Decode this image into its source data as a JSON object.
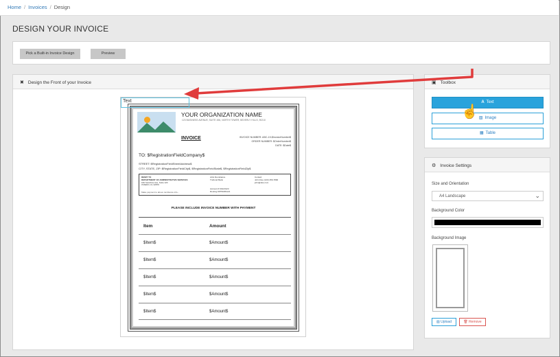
{
  "breadcrumb": {
    "home": "Home",
    "invoices": "Invoices",
    "current": "Design",
    "separator": "/"
  },
  "page": {
    "title": "DESIGN YOUR INVOICE"
  },
  "actions": {
    "pick_label": "Pick a Built-in Invoice Design",
    "preview_label": "Preview"
  },
  "design": {
    "panel_title": "Design the Front of your Invoice",
    "text_element": "Text",
    "invoice": {
      "org_name": "YOUR ORGANIZATION NAME",
      "org_address": "123 BUSINESS AVENUE, SUITE 456, NORTH TOWER, BEVERLY HILLS, 90210",
      "title": "INVOICE",
      "meta_number": "INVOICE NUMBER: ABC-19-$InvoiceNumber$",
      "meta_order": "ORDER NUMBER: $OrderNumber$",
      "meta_date": "DATE: $Date$",
      "to": "TO: $RegistrationFieldCompany$",
      "street": "STREET: $RegistrationFieldStreetAddress$",
      "city": "CITY, STATE, ZIP: $RegistrationFieldCity$, $RegistrationFieldState$, $RegistrationFieldZip$",
      "remit": {
        "c1": [
          "REMIT TO",
          "DEPARTMENT OF ADMINISTRATIVE SERVICES",
          "160 Sunshine Ave, Suite 120",
          "OVIEDO, FL 32870"
        ],
        "c2": [
          "ACH Remittance",
          "TruFund Bank"
        ],
        "c2b": [
          "Account # 00123123",
          "Routing #9751081121"
        ],
        "c3": [
          "Contact",
          "John Doe (123) 456-7890",
          "john@doe.com"
        ],
        "foot": "Make payment to above remittance info..."
      },
      "please": "PLEASE INCLUDE INVOICE NUMBER WITH PAYMENT",
      "table": {
        "headers": [
          "Item",
          "Amount"
        ],
        "rows": [
          [
            "$Item$",
            "$Amount$"
          ],
          [
            "$Item$",
            "$Amount$"
          ],
          [
            "$Item$",
            "$Amount$"
          ],
          [
            "$Item$",
            "$Amount$"
          ],
          [
            "$Item$",
            "$Amount$"
          ]
        ]
      }
    }
  },
  "toolbox": {
    "title": "Toolbox",
    "text_label": "Text",
    "image_label": "Image",
    "table_label": "Table"
  },
  "settings": {
    "title": "Invoice Settings",
    "size_label": "Size and Orientation",
    "size_value": "A4   Landscape",
    "bg_color_label": "Background Color",
    "bg_color_value": "#000000",
    "bg_image_label": "Background Image",
    "upload_label": "Upload",
    "remove_label": "Remove"
  },
  "colors": {
    "accent": "#29a3dc",
    "arrow": "#e03c3c",
    "danger": "#d9534f"
  }
}
